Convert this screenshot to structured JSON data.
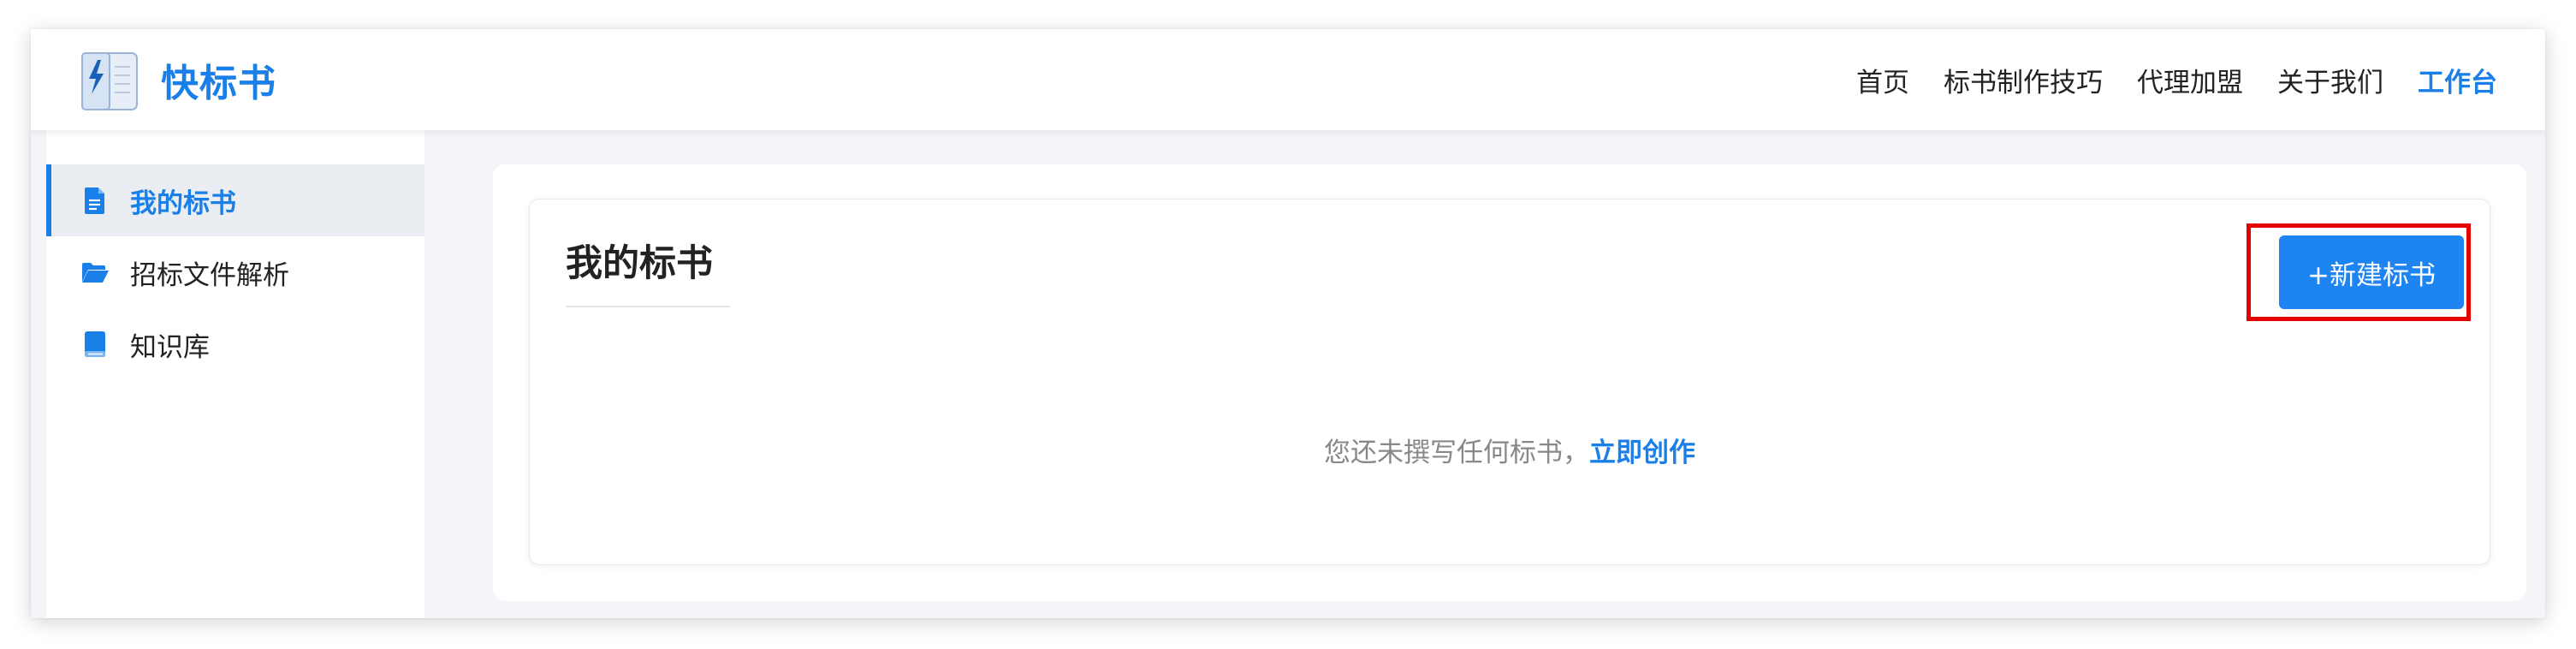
{
  "header": {
    "logo_text": "快标书",
    "logo_icon": "book-lightning-icon",
    "nav": [
      {
        "label": "首页",
        "active": false
      },
      {
        "label": "标书制作技巧",
        "active": false
      },
      {
        "label": "代理加盟",
        "active": false
      },
      {
        "label": "关于我们",
        "active": false
      },
      {
        "label": "工作台",
        "active": true
      }
    ]
  },
  "sidebar": {
    "items": [
      {
        "label": "我的标书",
        "icon": "document-icon",
        "active": true
      },
      {
        "label": "招标文件解析",
        "icon": "folder-open-icon",
        "active": false
      },
      {
        "label": "知识库",
        "icon": "book-icon",
        "active": false
      }
    ]
  },
  "main": {
    "title": "我的标书",
    "new_button_label": "+新建标书",
    "empty_text": "您还未撰写任何标书，",
    "create_link": "立即创作"
  },
  "colors": {
    "accent": "#1a7fe8",
    "button": "#1d84f2",
    "highlight": "#e50000"
  }
}
